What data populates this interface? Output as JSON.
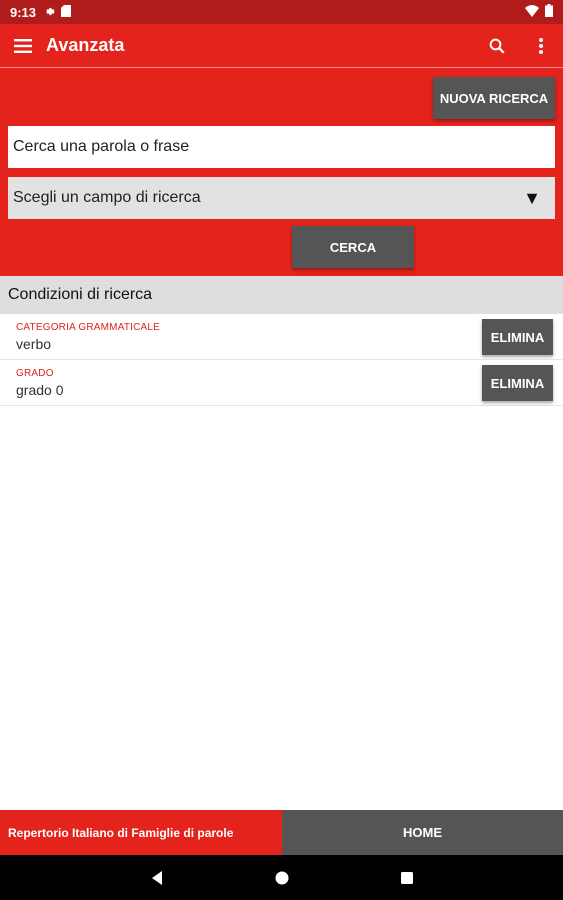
{
  "status_bar": {
    "time": "9:13",
    "icons": [
      "gear-icon",
      "sd-card-icon",
      "wifi-icon",
      "battery-icon"
    ]
  },
  "app_bar": {
    "title": "Avanzata",
    "icons": [
      "menu-icon",
      "search-icon",
      "more-vert-icon"
    ]
  },
  "search_panel": {
    "new_search_label": "NUOVA RICERCA",
    "search_placeholder": "Cerca una parola o frase",
    "field_select_value": "Scegli un campo di ricerca",
    "search_button_label": "CERCA"
  },
  "conditions": {
    "header": "Condizioni di ricerca",
    "items": [
      {
        "label": "CATEGORIA GRAMMATICALE",
        "value": "verbo",
        "delete_label": "ELIMINA"
      },
      {
        "label": "GRADO",
        "value": "grado 0",
        "delete_label": "ELIMINA"
      }
    ]
  },
  "footer": {
    "left_text": "Repertorio Italiano di Famiglie di parole",
    "home_label": "HOME"
  },
  "colors": {
    "primary": "#e3231c",
    "status_bar": "#b01c1c",
    "button_dark": "#555555",
    "header_grey": "#dedede"
  }
}
